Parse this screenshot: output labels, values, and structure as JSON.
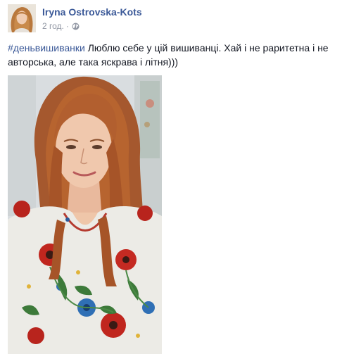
{
  "post": {
    "author_name": "Iryna Ostrovska-Kots",
    "timestamp": "2 год.",
    "separator": "·",
    "privacy_icon": "globe-icon",
    "hashtag": "#деньвишиванки",
    "text": " Люблю себе у цій вишиванці. Хай і не раритетна і не авторська, але така яскрава і літня)))"
  },
  "colors": {
    "link_blue": "#3b5998",
    "meta_grey": "#9197a3",
    "text_dark": "#141823"
  }
}
